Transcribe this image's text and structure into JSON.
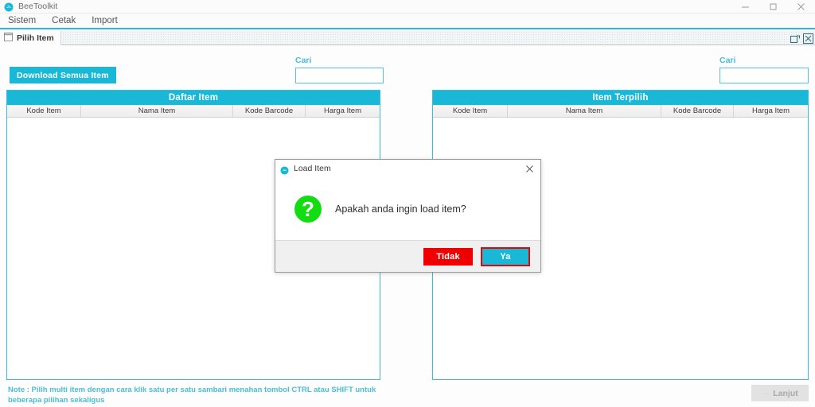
{
  "window": {
    "title": "BeeToolkit",
    "logo_icon": "beetoolkit-logo-icon",
    "controls": {
      "minimize": "minimize-icon",
      "maximize": "maximize-icon",
      "close": "close-icon"
    }
  },
  "menubar": {
    "items": [
      {
        "label": "Sistem"
      },
      {
        "label": "Cetak"
      },
      {
        "label": "Import"
      }
    ]
  },
  "tabstrip": {
    "tab_label": "Pilih Item",
    "tab_icon": "window-tab-icon",
    "restore_icon": "restore-window-icon",
    "close_icon": "close-window-icon"
  },
  "left_panel": {
    "download_button": "Download Semua Item",
    "search_label": "Cari",
    "search_value": "",
    "search_placeholder": "",
    "grid": {
      "title": "Daftar Item",
      "columns": [
        "Kode Item",
        "Nama Item",
        "Kode Barcode",
        "Harga Item"
      ],
      "rows": []
    }
  },
  "right_panel": {
    "search_label": "Cari",
    "search_value": "",
    "search_placeholder": "",
    "grid": {
      "title": "Item Terpilih",
      "columns": [
        "Kode Item",
        "Nama Item",
        "Kode Barcode",
        "Harga Item"
      ],
      "rows": []
    }
  },
  "footer": {
    "note": "Note : Pilih multi item dengan cara klik satu per satu sambari menahan tombol CTRL atau SHIFT untuk beberapa pilihan sekaligus",
    "continue_button": "Lanjut",
    "continue_arrow": "→",
    "continue_disabled": true
  },
  "dialog": {
    "title": "Load Item",
    "logo_icon": "beetoolkit-logo-icon",
    "close_icon": "close-icon",
    "question_icon": "question-icon",
    "question_glyph": "?",
    "message": "Apakah anda ingin load item?",
    "buttons": {
      "no": "Tidak",
      "yes": "Ya"
    }
  },
  "colors": {
    "accent": "#18b8d6",
    "accent_light": "#4bbdd8",
    "danger": "#ee0000",
    "success": "#11dd11",
    "disabled": "#e2e2e2"
  }
}
